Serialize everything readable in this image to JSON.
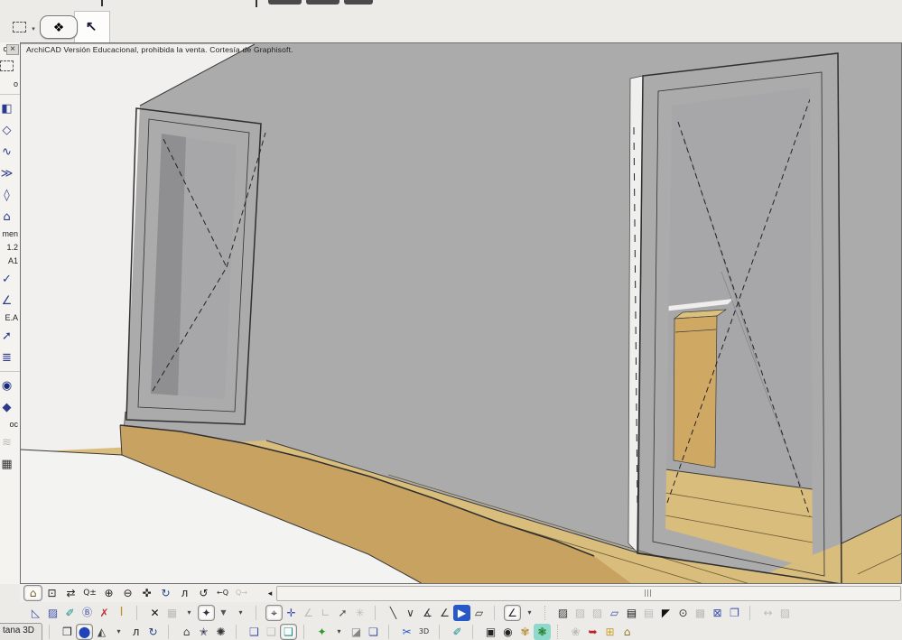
{
  "banner": {
    "text": "ArchiCAD Versión Educacional, prohibida la venta. Cortesía de Graphisoft.",
    "close_glyph": "×"
  },
  "top_toolbar": {
    "items": [
      {
        "name": "marquee-tool-button",
        "cls": "marquee",
        "glyph": ""
      },
      {
        "name": "marquee-dropdown-arrow",
        "glyph": "▾",
        "fs": "8px",
        "color": "#444"
      },
      {
        "name": "paint-eraser-button",
        "glyph": "❖",
        "pressed": true,
        "color": "#222"
      },
      {
        "name": "arrow-tool-button",
        "glyph": "↖",
        "color": "#1a1a3a"
      }
    ]
  },
  "sidebar": {
    "items": [
      {
        "type": "label",
        "name": "section-seleccion-label",
        "text": "ción"
      },
      {
        "name": "marquee-tool-icon",
        "cls": "marquee",
        "glyph": ""
      },
      {
        "type": "label",
        "name": "section-diseno-label",
        "text": "o"
      },
      {
        "type": "seph"
      },
      {
        "name": "wall-tool-icon",
        "glyph": "◧",
        "color": "#2b3a8c"
      },
      {
        "name": "door-tool-icon",
        "glyph": "◇",
        "color": "#2b3a8c"
      },
      {
        "name": "window-tool-icon",
        "glyph": "∿",
        "color": "#2b3a8c"
      },
      {
        "name": "object-tool-icon",
        "glyph": "≫",
        "color": "#2b3a8c"
      },
      {
        "name": "slab-tool-icon",
        "glyph": "◊",
        "color": "#2b3a8c"
      },
      {
        "name": "roof-tool-icon",
        "glyph": "⌂",
        "color": "#2b3a8c"
      },
      {
        "type": "label",
        "name": "section-documento-label",
        "text": "men"
      },
      {
        "type": "label",
        "name": "level-dim-label",
        "text": "1.2"
      },
      {
        "type": "label",
        "name": "text-tool-label",
        "text": "A1"
      },
      {
        "name": "check-tool-icon",
        "glyph": "✓",
        "color": "#2b3a8c"
      },
      {
        "name": "dimension-tool-icon",
        "glyph": "∠",
        "color": "#2b3a8c"
      },
      {
        "type": "label",
        "name": "detail-tool-label",
        "text": "E.A"
      },
      {
        "name": "arrow-annotation-icon",
        "glyph": "➚",
        "color": "#2b3a8c"
      },
      {
        "name": "lines-tool-icon",
        "glyph": "≣",
        "color": "#2b3a8c"
      },
      {
        "type": "seph"
      },
      {
        "name": "camera-tool-icon",
        "glyph": "◉",
        "color": "#1a2a7a"
      },
      {
        "name": "shape-tool-icon",
        "glyph": "◆",
        "color": "#2b3a8c"
      },
      {
        "type": "label",
        "name": "section-mas-label",
        "text": "oc"
      },
      {
        "name": "mesh-tool-icon",
        "glyph": "≋",
        "disabled": true
      },
      {
        "name": "module-tool-icon",
        "glyph": "▦",
        "color": "#333"
      }
    ]
  },
  "nav_toolbar": {
    "items": [
      {
        "name": "fit-in-window-button",
        "glyph": "⌂",
        "pressed": true,
        "color": "#6a5a20"
      },
      {
        "name": "zoom-window-button",
        "glyph": "⊡",
        "color": "#222"
      },
      {
        "name": "pan-zoom-button",
        "glyph": "⇄",
        "color": "#222"
      },
      {
        "name": "zoom-in-out-button",
        "glyph": "Q±",
        "fs": "9px",
        "color": "#222"
      },
      {
        "name": "zoom-in-button",
        "glyph": "⊕",
        "color": "#222"
      },
      {
        "name": "zoom-out-button",
        "glyph": "⊖",
        "color": "#222"
      },
      {
        "name": "pan-hand-button",
        "glyph": "✜",
        "color": "#222"
      },
      {
        "name": "orbit-button",
        "glyph": "↻",
        "color": "#224488"
      },
      {
        "name": "walk-button",
        "glyph": "л",
        "color": "#222"
      },
      {
        "name": "refresh-zoom-button",
        "glyph": "↺",
        "color": "#222"
      },
      {
        "name": "previous-zoom-button",
        "glyph": "←Q",
        "fs": "8px",
        "color": "#222"
      },
      {
        "name": "next-zoom-button",
        "glyph": "Q→",
        "fs": "8px",
        "disabled": true
      }
    ],
    "scroll_left_glyph": "◂"
  },
  "snap_toolbar": {
    "items": [
      {
        "name": "fill-slope-icon",
        "glyph": "◺",
        "color": "#3b4fae"
      },
      {
        "name": "fill-pattern-icon",
        "glyph": "▨",
        "color": "#3b4fae"
      },
      {
        "name": "paintbrush-button",
        "glyph": "✐",
        "color": "#0e8f8f"
      },
      {
        "name": "label-button",
        "glyph": "Ⓑ",
        "color": "#3b4fae",
        "fs": "11px"
      },
      {
        "name": "delete-redline-button",
        "glyph": "✗",
        "color": "#bb3333"
      },
      {
        "name": "column-profile-button",
        "glyph": "I",
        "color": "#b8922a",
        "fs": "13px"
      },
      {
        "type": "sep"
      },
      {
        "name": "detach-button",
        "glyph": "✕",
        "color": "#111"
      },
      {
        "name": "grid-snap-button",
        "glyph": "▦",
        "disabled": true
      },
      {
        "name": "grid-dropdown-arrow",
        "glyph": "▾",
        "fs": "8px",
        "color": "#444"
      },
      {
        "name": "suspend-groups-button",
        "glyph": "✦",
        "pressed": true,
        "color": "#334"
      },
      {
        "name": "gravity-button",
        "glyph": "▼",
        "fs": "8px",
        "color": "#555"
      },
      {
        "name": "gravity-dropdown-arrow",
        "glyph": "▾",
        "fs": "8px",
        "color": "#444"
      },
      {
        "type": "sep"
      },
      {
        "name": "cursor-snap-button",
        "glyph": "⌖",
        "pressed": true,
        "color": "#223"
      },
      {
        "name": "snap-point-button",
        "glyph": "✛",
        "color": "#3b4fae"
      },
      {
        "name": "angle-bisector-button",
        "glyph": "∠",
        "disabled": true
      },
      {
        "name": "perpendicular-button",
        "glyph": "∟",
        "disabled": true
      },
      {
        "name": "snap-reference-button",
        "glyph": "➚",
        "color": "#555"
      },
      {
        "name": "snap-star-button",
        "glyph": "✳",
        "disabled": true
      },
      {
        "type": "sep"
      },
      {
        "name": "offset-line-button",
        "glyph": "╲",
        "color": "#333"
      },
      {
        "name": "arc-angle-button",
        "glyph": "∨",
        "color": "#333"
      },
      {
        "name": "measure-angle-button",
        "glyph": "∡",
        "color": "#333"
      },
      {
        "name": "direction-constraint-button",
        "glyph": "∠",
        "color": "#333"
      },
      {
        "name": "play-coordinates-button",
        "glyph": "▶",
        "color": "#ffffff",
        "bg": "#2857c8"
      },
      {
        "name": "rotated-grid-button",
        "glyph": "▱",
        "color": "#333"
      },
      {
        "type": "sep"
      },
      {
        "name": "relative-angle-button",
        "glyph": "∠",
        "pressed": true,
        "color": "#223"
      },
      {
        "name": "relative-angle-dropdown",
        "glyph": "▾",
        "fs": "8px",
        "color": "#444"
      },
      {
        "type": "dotsep"
      },
      {
        "name": "fill-display-button",
        "glyph": "▨",
        "color": "#333"
      },
      {
        "name": "fill-background-button",
        "glyph": "▨",
        "disabled": true
      },
      {
        "name": "fill-vector-button",
        "glyph": "▨",
        "disabled": true
      },
      {
        "name": "slab-contour-button",
        "glyph": "▱",
        "color": "#3b4fae"
      },
      {
        "name": "section-fill-button",
        "glyph": "▤",
        "color": "#111"
      },
      {
        "name": "section-fill-alt-button",
        "glyph": "▤",
        "disabled": true
      },
      {
        "name": "magic-wand-button",
        "glyph": "◤",
        "color": "#111"
      },
      {
        "name": "selection-target-button",
        "glyph": "⊙",
        "color": "#333"
      },
      {
        "name": "fill-selection-button",
        "glyph": "▩",
        "disabled": true
      },
      {
        "name": "marquee-lock-button",
        "glyph": "⊠",
        "color": "#3b4fae"
      },
      {
        "name": "duplicate-layers-button",
        "glyph": "❐",
        "color": "#3b4fae"
      },
      {
        "type": "sep"
      },
      {
        "name": "stretch-button",
        "glyph": "↔",
        "disabled": true
      },
      {
        "name": "hatch-angle-button",
        "glyph": "▨",
        "disabled": true
      }
    ]
  },
  "bottom_toolbar": {
    "tab_label": "tana 3D",
    "items": [
      {
        "type": "sep"
      },
      {
        "name": "axonometry-box-button",
        "glyph": "❒",
        "color": "#222"
      },
      {
        "name": "perspective-button",
        "glyph": "⬤",
        "pressed": true,
        "color": "#2244bb"
      },
      {
        "name": "projection-settings-button",
        "glyph": "◭",
        "color": "#444"
      },
      {
        "name": "projection-dropdown-arrow",
        "glyph": "▾",
        "fs": "8px",
        "color": "#444"
      },
      {
        "name": "walk-mode-button",
        "glyph": "л",
        "color": "#222"
      },
      {
        "name": "orbit-mode-button",
        "glyph": "↻",
        "color": "#224488"
      },
      {
        "type": "sep"
      },
      {
        "name": "home-view-button",
        "glyph": "⌂",
        "color": "#444"
      },
      {
        "name": "look-to-button",
        "glyph": "✭",
        "color": "#335"
      },
      {
        "name": "explode-view-button",
        "glyph": "✺",
        "color": "#333"
      },
      {
        "type": "sep"
      },
      {
        "name": "copy-image-button",
        "glyph": "❑",
        "color": "#3b4fae"
      },
      {
        "name": "paste-image-button",
        "glyph": "❑",
        "disabled": true
      },
      {
        "name": "capture-view-button",
        "glyph": "❑",
        "pressed": true,
        "color": "#0e8f8f"
      },
      {
        "type": "sep"
      },
      {
        "name": "add-element-button",
        "glyph": "✦",
        "color": "#2a9a2a"
      },
      {
        "name": "add-element-dropdown",
        "glyph": "▾",
        "fs": "8px",
        "color": "#444"
      },
      {
        "name": "eraser-button",
        "glyph": "◪",
        "color": "#888"
      },
      {
        "name": "open-document-button",
        "glyph": "❏",
        "color": "#3b4fae"
      },
      {
        "type": "sep"
      },
      {
        "name": "cut-3d-button",
        "glyph": "✂",
        "color": "#2255cc"
      },
      {
        "name": "show-3d-button",
        "glyph": "3D",
        "fs": "8px",
        "color": "#333"
      },
      {
        "type": "sep"
      },
      {
        "name": "brush-3d-button",
        "glyph": "✐",
        "color": "#0e8f8f"
      },
      {
        "type": "sep"
      },
      {
        "name": "photo-render-button",
        "glyph": "▣",
        "color": "#222"
      },
      {
        "name": "render-settings-button",
        "glyph": "◉",
        "color": "#222"
      },
      {
        "name": "rendering-duck-button",
        "glyph": "✾",
        "color": "#b8943f"
      },
      {
        "name": "photorender-scene-button",
        "glyph": "❃",
        "color": "#1b7a1b",
        "bg": "#8fd8cc"
      },
      {
        "type": "dotsep"
      },
      {
        "name": "texture-button",
        "glyph": "❀",
        "disabled": true
      },
      {
        "name": "send-model-button",
        "glyph": "➥",
        "color": "#bb2222"
      },
      {
        "name": "publish-note-button",
        "glyph": "⊞",
        "color": "#caa32e"
      },
      {
        "name": "upload-model-button",
        "glyph": "⌂",
        "color": "#8a7a2a"
      }
    ]
  },
  "scene": {
    "colors": {
      "wall": "#ababab",
      "white_wall": "#f1f0ee",
      "slab": "#f3f3f1",
      "frame": "#d6b470",
      "band": "#c8a261",
      "floor": "#d9bd7d",
      "glass": "#a7a7a9",
      "glass_dark": "#8f8f91",
      "cabinet": "#cfa964",
      "cabinet_top": "#dcc07e",
      "counter": "#efeeec",
      "sliver": "#efefed"
    }
  }
}
